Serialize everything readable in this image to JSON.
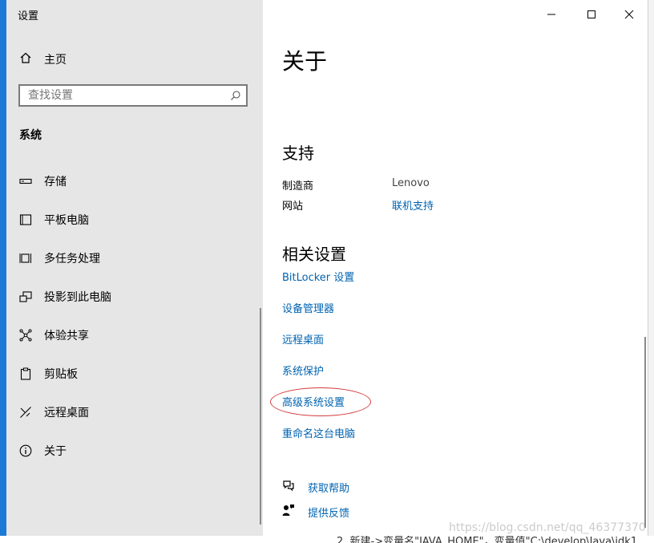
{
  "window": {
    "title": "设置"
  },
  "sidebar": {
    "home_label": "主页",
    "search_placeholder": "查找设置",
    "section": "系统",
    "items": [
      {
        "label": "存储",
        "icon": "storage-icon"
      },
      {
        "label": "平板电脑",
        "icon": "tablet-icon"
      },
      {
        "label": "多任务处理",
        "icon": "multitasking-icon"
      },
      {
        "label": "投影到此电脑",
        "icon": "project-icon"
      },
      {
        "label": "体验共享",
        "icon": "shared-experiences-icon"
      },
      {
        "label": "剪贴板",
        "icon": "clipboard-icon"
      },
      {
        "label": "远程桌面",
        "icon": "remote-desktop-icon"
      },
      {
        "label": "关于",
        "icon": "info-icon"
      }
    ]
  },
  "main": {
    "title": "关于",
    "support": {
      "heading": "支持",
      "manufacturer_label": "制造商",
      "manufacturer_value": "Lenovo",
      "website_label": "网站",
      "website_link": "联机支持"
    },
    "related": {
      "heading": "相关设置",
      "links": [
        "BitLocker 设置",
        "设备管理器",
        "远程桌面",
        "系统保护",
        "高级系统设置",
        "重命名这台电脑"
      ]
    },
    "help": {
      "get_help": "获取帮助",
      "feedback": "提供反馈"
    }
  },
  "annotation_color": "#d23b3b",
  "link_color": "#0063b1",
  "background": {
    "bottom_text": "2. 新建->变量名\"JAVA_HOME\"，变量值\"C:\\develop\\Java\\jdk1",
    "watermark": "https://blog.csdn.net/qq_46377370"
  }
}
